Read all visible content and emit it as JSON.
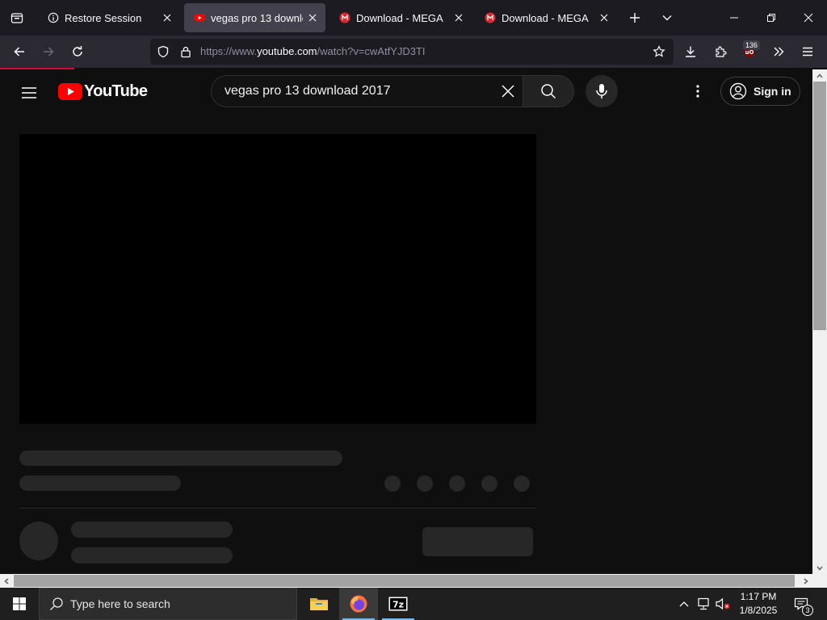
{
  "browser": {
    "tabs": [
      {
        "title": "Restore Session",
        "active": false
      },
      {
        "title": "vegas pro 13 download",
        "active": true
      },
      {
        "title": "Download - MEGA",
        "active": false
      },
      {
        "title": "Download - MEGA",
        "active": false
      }
    ],
    "url_prefix": "https://www.",
    "url_host": "youtube.com",
    "url_path": "/watch?v=cwAtfYJD3TI",
    "extension_badge": "136",
    "colors": {
      "tabbar": "#1c1b22",
      "navbar": "#2b2a33",
      "active_tab": "#42414d",
      "loading_bar": "#e0003b"
    }
  },
  "youtube": {
    "logo_text": "YouTube",
    "search_value": "vegas pro 13 download 2017",
    "sign_in_label": "Sign in",
    "colors": {
      "brand_red": "#ff0000",
      "background": "#0f0f0f",
      "skeleton": "#272727"
    }
  },
  "taskbar": {
    "search_placeholder": "Type here to search",
    "time": "1:17 PM",
    "date": "1/8/2025",
    "notification_count": "3",
    "apps": [
      "file-explorer-icon",
      "firefox-icon",
      "7zip-icon"
    ]
  }
}
